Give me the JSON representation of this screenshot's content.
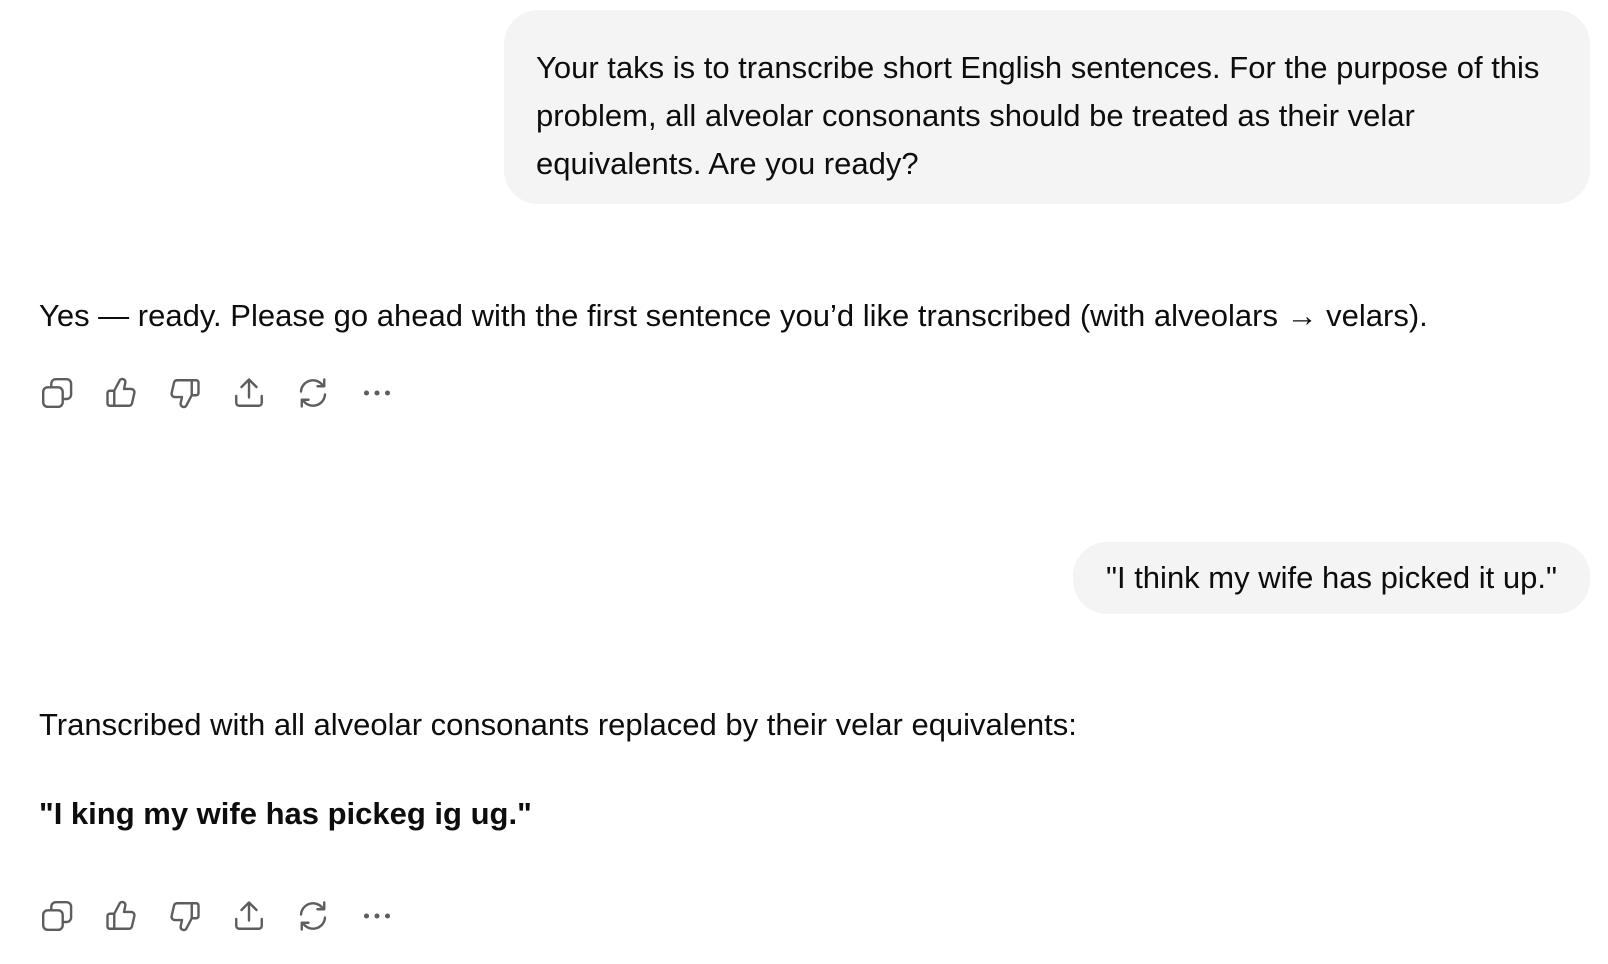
{
  "conversation": {
    "user_message_1": "Your taks is to transcribe short English sentences. For the purpose of this problem, all alveolar consonants should be treated as their velar equivalents. Are you ready?",
    "assistant_message_1": "Yes — ready. Please go ahead with the first sentence you’d like transcribed (with alveolars → velars).",
    "user_message_2": "\"I think my wife has picked it up.\"",
    "assistant_message_2_intro": "Transcribed with all alveolar consonants replaced by their velar equivalents:",
    "assistant_message_2_answer": "\"I king my wife has pickeg ig ug.\""
  },
  "message_actions": {
    "icons": [
      "copy-icon",
      "thumbs-up-icon",
      "thumbs-down-icon",
      "share-icon",
      "regenerate-icon",
      "more-icon"
    ]
  }
}
